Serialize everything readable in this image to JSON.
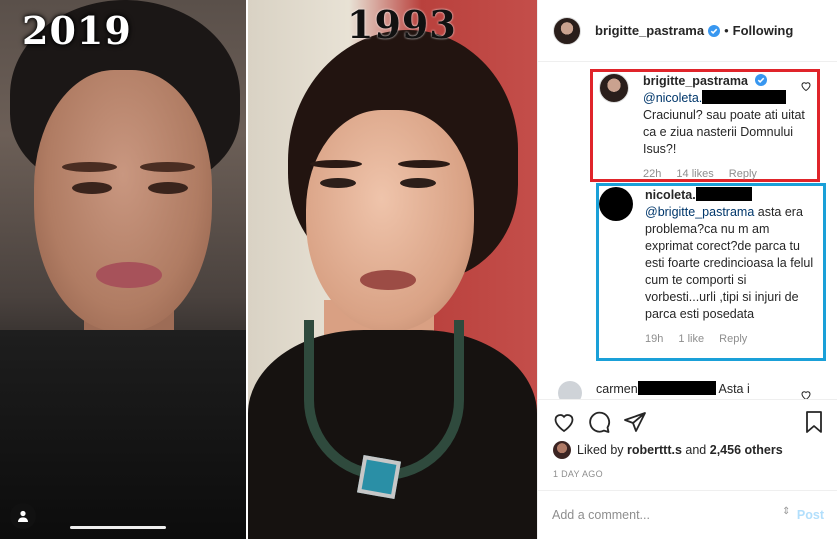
{
  "media": {
    "label_left": "2019",
    "label_right": "1993"
  },
  "header": {
    "username": "brigitte_pastrama",
    "separator": "•",
    "follow_status": "Following"
  },
  "comments": [
    {
      "username": "brigitte_pastrama",
      "mention": "@nicoleta.",
      "text": "Craciunul? sau poate ati uitat ca e ziua nasterii Domnului Isus?!",
      "time": "22h",
      "likes": "14 likes",
      "reply": "Reply"
    },
    {
      "username": "nicoleta.",
      "mention": "@brigitte_pastrama",
      "text": "asta era problema?ca nu m am exprimat corect?de parca tu esti foarte credincioasa la felul cum te comporti si vorbesti...urli ,tipi si injuri de parca esti posedata",
      "time": "19h",
      "likes": "1 like",
      "reply": "Reply"
    },
    {
      "username": "carmen",
      "text": "Asta i"
    }
  ],
  "likes": {
    "prefix": "Liked by",
    "user": "roberttt.s",
    "middle": "and",
    "others": "2,456 others"
  },
  "timestamp": "1 DAY AGO",
  "composer": {
    "placeholder": "Add a comment...",
    "post_label": "Post"
  },
  "colors": {
    "highlight_red": "#e0242a",
    "highlight_blue": "#1aa0d8",
    "verified_blue": "#3897f0",
    "post_disabled": "#b2dffc"
  }
}
